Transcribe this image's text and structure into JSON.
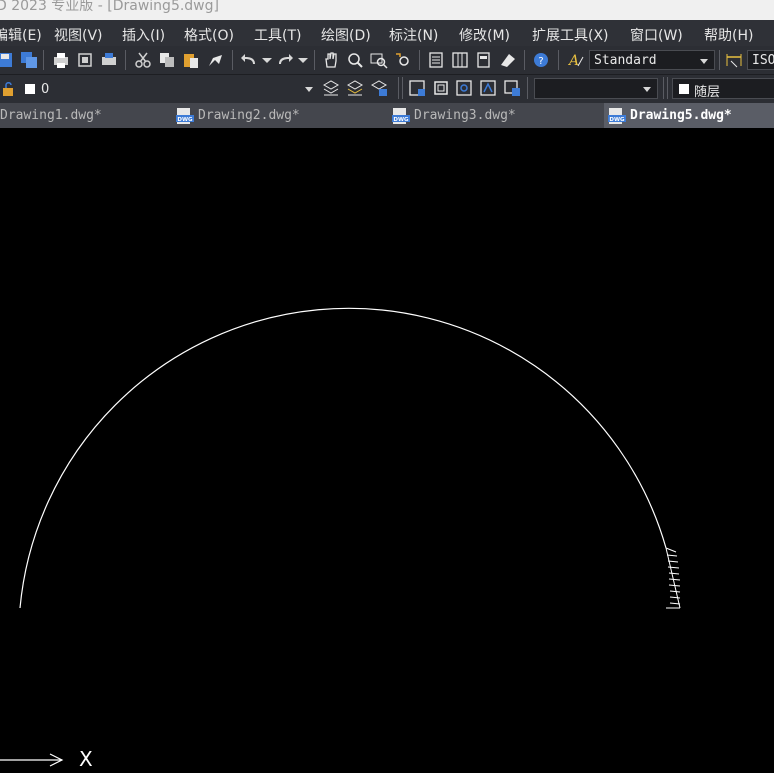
{
  "window": {
    "title": "D 2023 专业版 - [Drawing5.dwg]"
  },
  "menu": {
    "items": [
      "编辑(E)",
      "视图(V)",
      "插入(I)",
      "格式(O)",
      "工具(T)",
      "绘图(D)",
      "标注(N)",
      "修改(M)",
      "扩展工具(X)",
      "窗口(W)",
      "帮助(H)"
    ]
  },
  "toolbar": {
    "text_style_value": "Standard",
    "dim_style_value": "ISO",
    "layer_value": "0",
    "linetype_value": "",
    "color_value": "随层"
  },
  "tabs": [
    {
      "label": "Drawing1.dwg*",
      "active": false
    },
    {
      "label": "Drawing2.dwg*",
      "active": false
    },
    {
      "label": "Drawing3.dwg*",
      "active": false
    },
    {
      "label": "Drawing5.dwg*",
      "active": true
    }
  ],
  "canvas": {
    "ucs_x_label": "X",
    "background": "#000000"
  },
  "colors": {
    "menubar_bg": "#2f3137",
    "toolbar_bg": "#2c2e34",
    "tabbar_bg": "#44464d",
    "active_tab_bg": "#5a5d66",
    "icon_blue": "#3d7bd6"
  }
}
